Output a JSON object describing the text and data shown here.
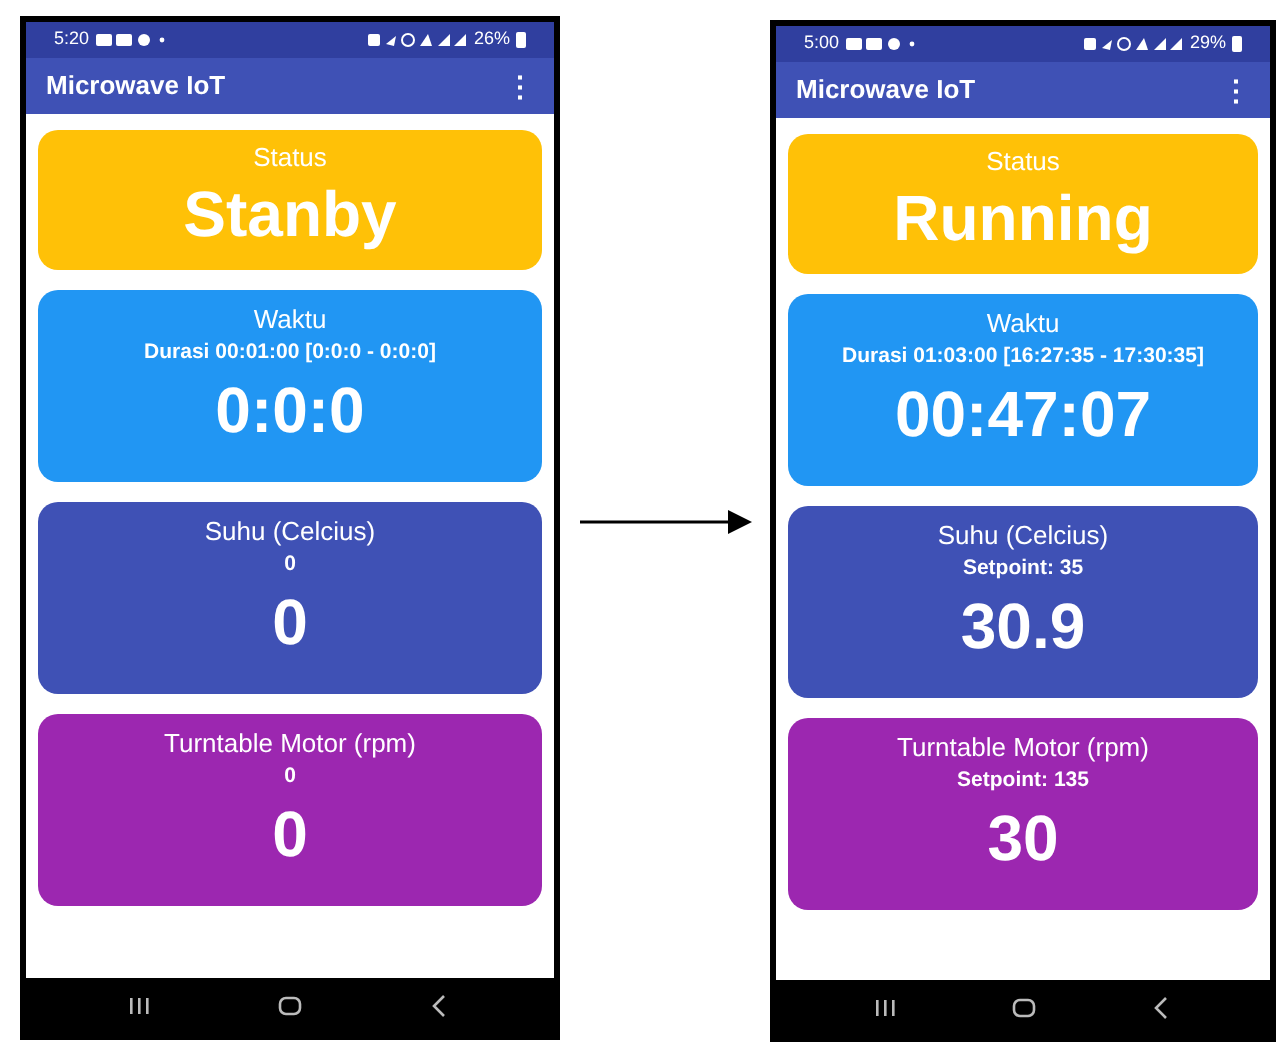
{
  "phones": [
    {
      "status_bar": {
        "time": "5:20",
        "battery": "26%"
      },
      "app_bar": {
        "title": "Microwave IoT",
        "menu": "⋮"
      },
      "cards": [
        {
          "label": "Status",
          "value": "Stanby",
          "color": "#ffc107"
        },
        {
          "label": "Waktu",
          "detail": "Durasi 00:01:00 [0:0:0 - 0:0:0]",
          "value": "0:0:0",
          "color": "#2196f3"
        },
        {
          "label": "Suhu (Celcius)",
          "detail": "0",
          "value": "0",
          "color": "#3f51b5"
        },
        {
          "label": "Turntable Motor (rpm)",
          "detail": "0",
          "value": "0",
          "color": "#9c27b0"
        }
      ]
    },
    {
      "status_bar": {
        "time": "5:00",
        "battery": "29%"
      },
      "app_bar": {
        "title": "Microwave IoT",
        "menu": "⋮"
      },
      "cards": [
        {
          "label": "Status",
          "value": "Running",
          "color": "#ffc107"
        },
        {
          "label": "Waktu",
          "detail": "Durasi 01:03:00 [16:27:35 - 17:30:35]",
          "value": "00:47:07",
          "color": "#2196f3"
        },
        {
          "label": "Suhu (Celcius)",
          "detail": "Setpoint: 35",
          "value": "30.9",
          "color": "#3f51b5"
        },
        {
          "label": "Turntable Motor (rpm)",
          "detail": "Setpoint: 135",
          "value": "30",
          "color": "#9c27b0"
        }
      ]
    }
  ]
}
